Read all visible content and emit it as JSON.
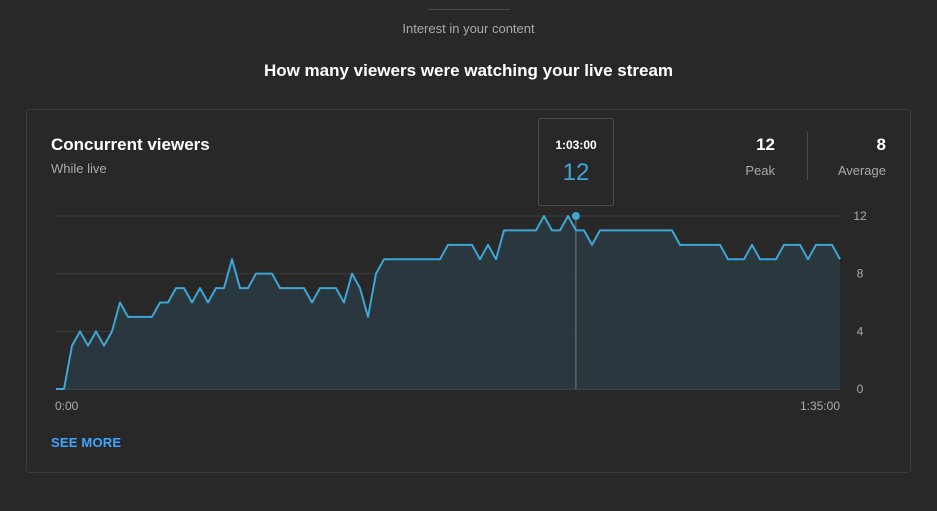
{
  "section_label": "Interest in your content",
  "headline": "How many viewers were watching your live stream",
  "card": {
    "title": "Concurrent viewers",
    "subtitle": "While live",
    "peak": {
      "value": "12",
      "label": "Peak"
    },
    "average": {
      "value": "8",
      "label": "Average"
    },
    "tooltip": {
      "time": "1:03:00",
      "value": "12"
    },
    "see_more": "SEE MORE"
  },
  "colors": {
    "line": "#3ea6d4",
    "link": "#3ea6ff",
    "background": "#282828"
  },
  "chart_data": {
    "type": "area",
    "title": "Concurrent viewers",
    "subtitle": "While live",
    "x_tick_labels": [
      "0:00",
      "1:35:00"
    ],
    "x_range_minutes": [
      0,
      95
    ],
    "y_ticks": [
      0,
      4,
      8,
      12
    ],
    "ylim": [
      0,
      12
    ],
    "grid": true,
    "highlight": {
      "x_minutes": 63,
      "y": 12,
      "label": "1:03:00"
    },
    "series": [
      {
        "values": [
          0,
          0,
          3,
          4,
          3,
          4,
          3,
          4,
          6,
          5,
          5,
          5,
          5,
          6,
          6,
          7,
          7,
          6,
          7,
          6,
          7,
          7,
          9,
          7,
          7,
          8,
          8,
          8,
          7,
          7,
          7,
          7,
          6,
          7,
          7,
          7,
          6,
          8,
          7,
          5,
          8,
          9,
          9,
          9,
          9,
          9,
          9,
          9,
          9,
          10,
          10,
          10,
          10,
          9,
          10,
          9,
          11,
          11,
          11,
          11,
          11,
          12,
          11,
          11,
          12,
          11,
          11,
          10,
          11,
          11,
          11,
          11,
          11,
          11,
          11,
          11,
          11,
          11,
          10,
          10,
          10,
          10,
          10,
          10,
          9,
          9,
          9,
          10,
          9,
          9,
          9,
          10,
          10,
          10,
          9,
          10,
          10,
          10,
          9
        ]
      }
    ]
  }
}
